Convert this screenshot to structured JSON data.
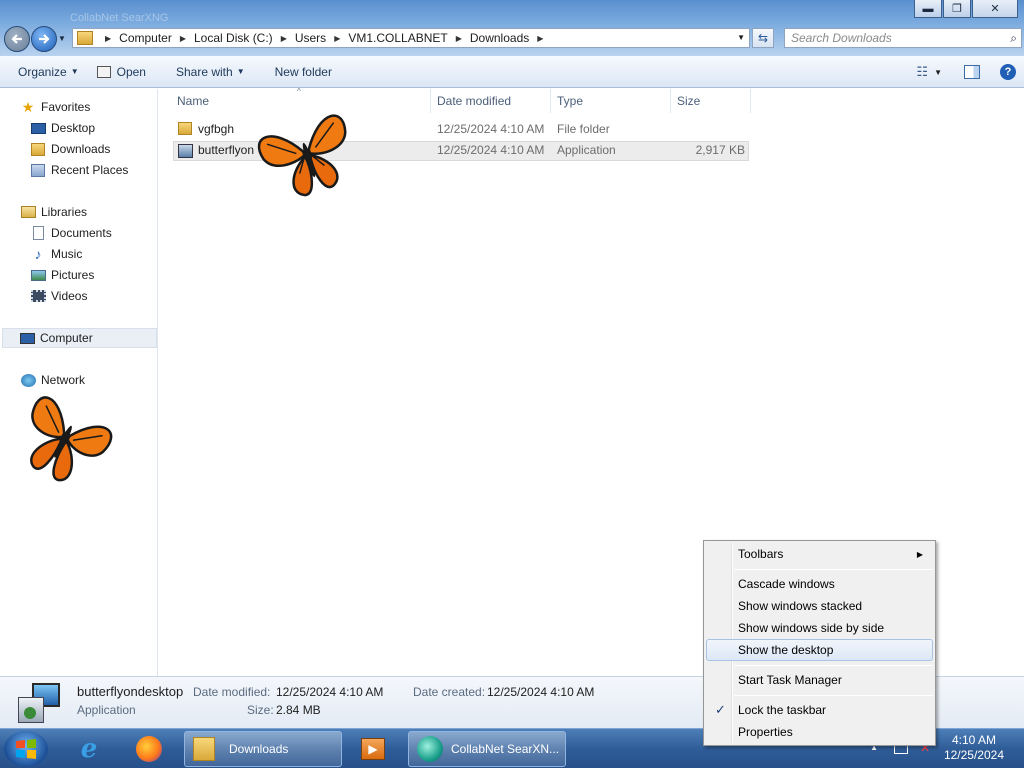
{
  "window": {
    "title": "CollabNet SearXNG",
    "controls": {
      "minimize": "▬",
      "maximize": "❐",
      "close": "✕"
    }
  },
  "address": {
    "crumbs": [
      "Computer",
      "Local Disk (C:)",
      "Users",
      "VM1.COLLABNET",
      "Downloads"
    ],
    "search_placeholder": "Search Downloads"
  },
  "toolbar": {
    "organize": "Organize",
    "open": "Open",
    "share_with": "Share with",
    "new_folder": "New folder"
  },
  "nav": {
    "favorites": "Favorites",
    "desktop": "Desktop",
    "downloads": "Downloads",
    "recent_places": "Recent Places",
    "libraries": "Libraries",
    "documents": "Documents",
    "music": "Music",
    "pictures": "Pictures",
    "videos": "Videos",
    "computer": "Computer",
    "network": "Network"
  },
  "columns": {
    "name": "Name",
    "date_modified": "Date modified",
    "type": "Type",
    "size": "Size"
  },
  "files": [
    {
      "name": "vgfbgh",
      "date": "12/25/2024 4:10 AM",
      "type": "File folder",
      "size": ""
    },
    {
      "name": "butterflyon",
      "date": "12/25/2024 4:10 AM",
      "type": "Application",
      "size": "2,917 KB"
    }
  ],
  "details": {
    "name": "butterflyondesktop",
    "type": "Application",
    "date_modified_label": "Date modified:",
    "date_modified": "12/25/2024 4:10 AM",
    "date_created_label": "Date created:",
    "date_created": "12/25/2024 4:10 AM",
    "size_label": "Size:",
    "size": "2.84 MB"
  },
  "taskbar": {
    "downloads_label": "Downloads",
    "collabnet_label": "CollabNet SearXN...",
    "time": "4:10 AM",
    "date": "12/25/2024"
  },
  "context_menu": {
    "toolbars": "Toolbars",
    "cascade": "Cascade windows",
    "stacked": "Show windows stacked",
    "side_by_side": "Show windows side by side",
    "show_desktop": "Show the desktop",
    "task_manager": "Start Task Manager",
    "lock_taskbar": "Lock the taskbar",
    "properties": "Properties"
  },
  "colors": {
    "accent": "#2f5d98",
    "selection": "#ececec",
    "menu_hover": "#dde8f6"
  }
}
